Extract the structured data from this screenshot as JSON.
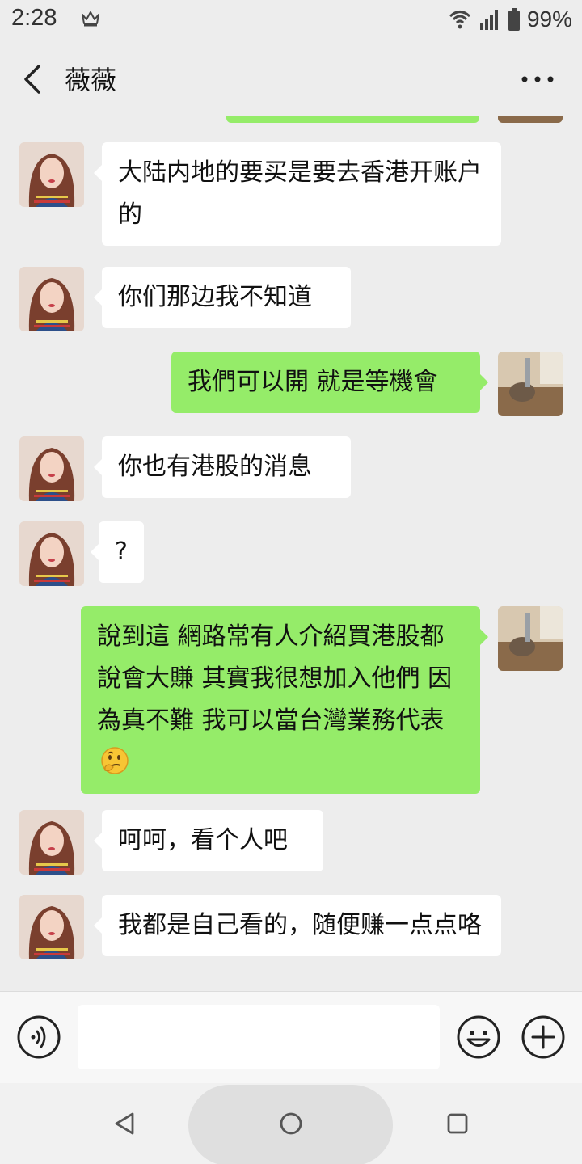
{
  "status_bar": {
    "time": "2:28",
    "battery": "99%"
  },
  "header": {
    "title": "薇薇"
  },
  "messages": [
    {
      "side": "left",
      "text": "大陆内地的要买是要去香港开账户的"
    },
    {
      "side": "left",
      "text": "你们那边我不知道"
    },
    {
      "side": "right",
      "text": "我們可以開 就是等機會"
    },
    {
      "side": "left",
      "text": "你也有港股的消息"
    },
    {
      "side": "left",
      "text": "?"
    },
    {
      "side": "right",
      "text": "說到這 網路常有人介紹買港股都說會大賺 其實我很想加入他們 因為真不難 我可以當台灣業務代表",
      "emoji": "thinking-face"
    },
    {
      "side": "left",
      "text": "呵呵，看个人吧"
    },
    {
      "side": "left",
      "text": "我都是自己看的，随便赚一点点咯"
    }
  ],
  "icons": {
    "contact_avatar": "woman-portrait-avatar",
    "self_avatar": "cat-photo-avatar"
  },
  "colors": {
    "sent_bubble": "#95ec69",
    "received_bubble": "#ffffff",
    "background": "#ededed"
  }
}
